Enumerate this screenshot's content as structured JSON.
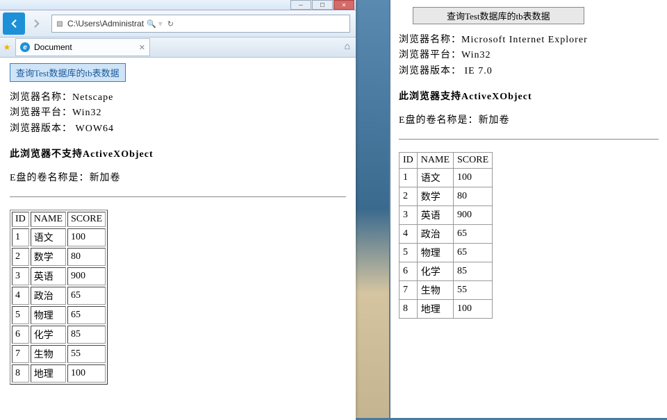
{
  "ie": {
    "url": "C:\\Users\\Administrat",
    "tab_label": "Document"
  },
  "left": {
    "query_button": "查询Test数据库的tb表数据",
    "browser_name_label": "浏览器名称：",
    "browser_name": "Netscape",
    "platform_label": "浏览器平台：",
    "platform": "Win32",
    "version_label": "浏览器版本：",
    "version": " WOW64",
    "support_text": "此浏览器不支持ActiveXObject",
    "disk_label": "E盘的卷名称是：",
    "disk_value": "新加卷",
    "table": {
      "headers": [
        "ID",
        "NAME",
        "SCORE"
      ],
      "rows": [
        [
          "1",
          "语文",
          "100"
        ],
        [
          "2",
          "数学",
          "80"
        ],
        [
          "3",
          "英语",
          "900"
        ],
        [
          "4",
          "政治",
          "65"
        ],
        [
          "5",
          "物理",
          "65"
        ],
        [
          "6",
          "化学",
          "85"
        ],
        [
          "7",
          "生物",
          "55"
        ],
        [
          "8",
          "地理",
          "100"
        ]
      ]
    }
  },
  "right": {
    "query_button": "查询Test数据库的tb表数据",
    "browser_name_label": "浏览器名称：",
    "browser_name": "Microsoft Internet Explorer",
    "platform_label": "浏览器平台：",
    "platform": "Win32",
    "version_label": "浏览器版本：",
    "version": " IE 7.0",
    "support_text": "此浏览器支持ActiveXObject",
    "disk_label": "E盘的卷名称是：",
    "disk_value": "新加卷",
    "table": {
      "headers": [
        "ID",
        "NAME",
        "SCORE"
      ],
      "rows": [
        [
          "1",
          "语文",
          "100"
        ],
        [
          "2",
          "数学",
          "80"
        ],
        [
          "3",
          "英语",
          "900"
        ],
        [
          "4",
          "政治",
          "65"
        ],
        [
          "5",
          "物理",
          "65"
        ],
        [
          "6",
          "化学",
          "85"
        ],
        [
          "7",
          "生物",
          "55"
        ],
        [
          "8",
          "地理",
          "100"
        ]
      ]
    }
  }
}
